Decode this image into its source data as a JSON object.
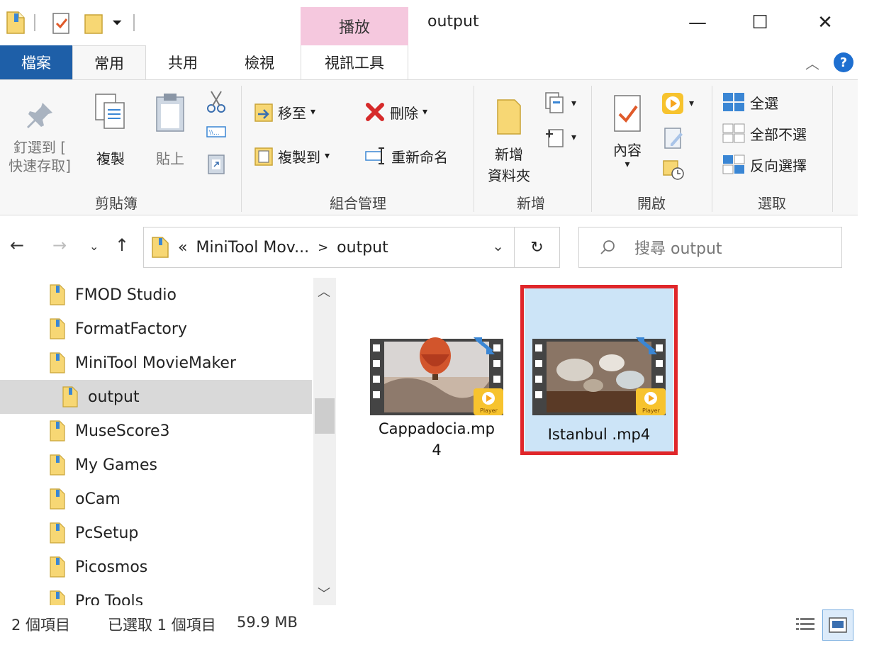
{
  "window": {
    "title": "output",
    "contextual_tab": "播放",
    "minimize": "—",
    "maximize": "☐",
    "close": "✕"
  },
  "tabs": {
    "file": "檔案",
    "home": "常用",
    "share": "共用",
    "view": "檢視",
    "video_tools": "視訊工具"
  },
  "ribbon": {
    "clipboard": {
      "label": "剪貼簿",
      "pin_line1": "釘選到 [",
      "pin_line2": "快速存取]",
      "copy": "複製",
      "paste": "貼上"
    },
    "organize": {
      "label": "組合管理",
      "move_to": "移至",
      "copy_to": "複製到",
      "delete": "刪除",
      "rename": "重新命名"
    },
    "new": {
      "label": "新增",
      "new_folder_line1": "新增",
      "new_folder_line2": "資料夾"
    },
    "open": {
      "label": "開啟",
      "properties": "內容"
    },
    "select": {
      "label": "選取",
      "select_all": "全選",
      "select_none": "全部不選",
      "invert": "反向選擇"
    }
  },
  "address": {
    "chevron": "«",
    "crumb1": "MiniTool Mov...",
    "separator": ">",
    "crumb2": "output",
    "search_placeholder": "搜尋 output"
  },
  "tree": [
    {
      "label": "FMOD Studio"
    },
    {
      "label": "FormatFactory"
    },
    {
      "label": "MiniTool MovieMaker"
    },
    {
      "label": "output"
    },
    {
      "label": "MuseScore3"
    },
    {
      "label": "My Games"
    },
    {
      "label": "oCam"
    },
    {
      "label": "PcSetup"
    },
    {
      "label": "Picosmos"
    },
    {
      "label": "Pro Tools"
    }
  ],
  "files": [
    {
      "name_line1": "Cappadocia.mp",
      "name_line2": "4",
      "badge": "Player"
    },
    {
      "name_line1": "Istanbul .mp4",
      "badge": "Player"
    }
  ],
  "status": {
    "count": "2 個項目",
    "selected": "已選取 1 個項目",
    "size": "59.9 MB"
  },
  "colors": {
    "accent": "#1e5fa8",
    "contextual": "#f5c8de",
    "selection": "#cce4f7",
    "highlight": "#e0262a",
    "folder": "#f7d774"
  }
}
